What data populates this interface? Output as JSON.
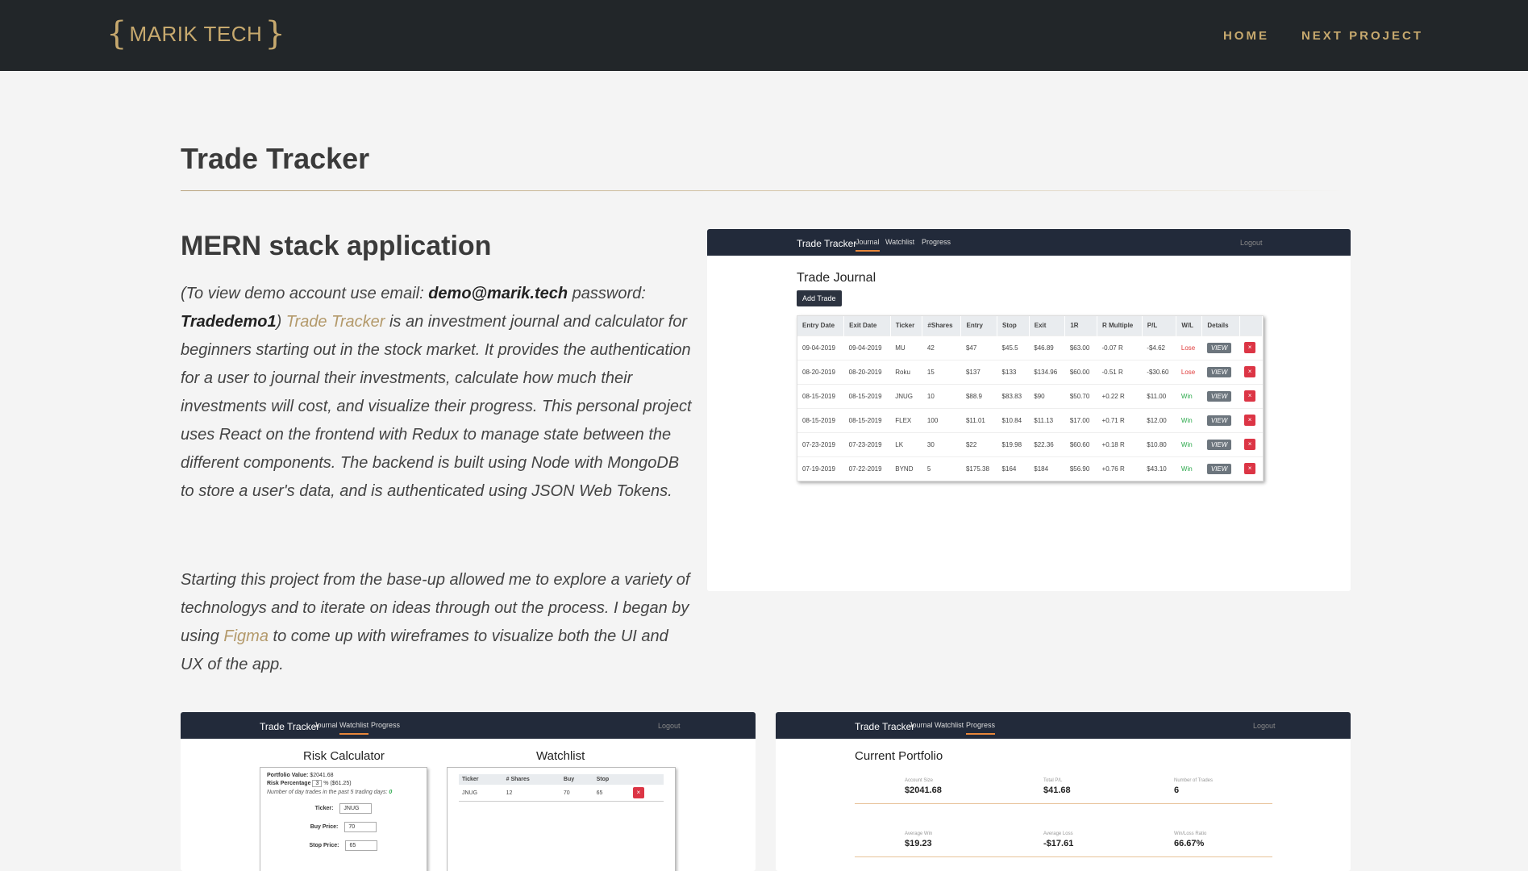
{
  "nav": {
    "logo_open": "{",
    "logo_text": "MARIK TECH",
    "logo_close": "}",
    "links": [
      "HOME",
      "NEXT PROJECT"
    ]
  },
  "page": {
    "title": "Trade Tracker",
    "section_title": "MERN stack application"
  },
  "description": {
    "p1_open_paren": "(",
    "p1_view_demo": "To view demo account use email: ",
    "p1_email": "demo@marik.tech",
    "p1_password_label": " password: ",
    "p1_password": "Tradedemo1",
    "p1_close_paren": ") ",
    "p1_link": "Trade Tracker",
    "p1_rest": " is an investment journal and calculator for beginners starting out in the stock market. It provides the authentication for a user to journal their investments, calculate how much their investments will cost, and visualize their progress. This personal project uses React on the frontend with Redux to manage state between the different components. The backend is built using Node with MongoDB to store a user's data, and is authenticated using JSON Web Tokens.",
    "p2_start": "Starting this project from the base-up allowed me to explore a variety of technologys and to iterate on ideas through out the process. I began by using ",
    "p2_link": "Figma",
    "p2_end": " to come up with wireframes to visualize both the UI and UX of the app."
  },
  "app": {
    "brand": "Trade Tracker",
    "tabs": [
      "Journal",
      "Watchlist",
      "Progress"
    ],
    "logout": "Logout"
  },
  "journal": {
    "title": "Trade Journal",
    "add_button": "Add Trade",
    "columns": [
      "Entry Date",
      "Exit Date",
      "Ticker",
      "#Shares",
      "Entry",
      "Stop",
      "Exit",
      "1R",
      "R Multiple",
      "P/L",
      "W/L",
      "Details",
      ""
    ],
    "rows": [
      [
        "09-04-2019",
        "09-04-2019",
        "MU",
        "42",
        "$47",
        "$45.5",
        "$46.89",
        "$63.00",
        "-0.07 R",
        "-$4.62",
        "Lose"
      ],
      [
        "08-20-2019",
        "08-20-2019",
        "Roku",
        "15",
        "$137",
        "$133",
        "$134.96",
        "$60.00",
        "-0.51 R",
        "-$30.60",
        "Lose"
      ],
      [
        "08-15-2019",
        "08-15-2019",
        "JNUG",
        "10",
        "$88.9",
        "$83.83",
        "$90",
        "$50.70",
        "+0.22 R",
        "$11.00",
        "Win"
      ],
      [
        "08-15-2019",
        "08-15-2019",
        "FLEX",
        "100",
        "$11.01",
        "$10.84",
        "$11.13",
        "$17.00",
        "+0.71 R",
        "$12.00",
        "Win"
      ],
      [
        "07-23-2019",
        "07-23-2019",
        "LK",
        "30",
        "$22",
        "$19.98",
        "$22.36",
        "$60.60",
        "+0.18 R",
        "$10.80",
        "Win"
      ],
      [
        "07-19-2019",
        "07-22-2019",
        "BYND",
        "5",
        "$175.38",
        "$164",
        "$184",
        "$56.90",
        "+0.76 R",
        "$43.10",
        "Win"
      ]
    ],
    "view_label": "VIEW",
    "delete_label": "×"
  },
  "risk": {
    "title": "Risk Calculator",
    "portfolio_label": "Portfolio Value:",
    "portfolio_value": "$2041.68",
    "risk_label": "Risk Percentage",
    "risk_value": "3",
    "risk_suffix": "% ($61.25)",
    "day_trades_note": "Number of day trades in the past 5 trading days:",
    "day_trades_count": "0",
    "ticker_label": "Ticker:",
    "ticker_value": "JNUG",
    "buy_label": "Buy Price:",
    "buy_value": "70",
    "stop_label": "Stop Price:",
    "stop_value": "65"
  },
  "watchlist": {
    "title": "Watchlist",
    "columns": [
      "Ticker",
      "# Shares",
      "Buy",
      "Stop",
      ""
    ],
    "rows": [
      [
        "JNUG",
        "12",
        "70",
        "65"
      ]
    ]
  },
  "portfolio": {
    "title": "Current Portfolio",
    "stats": [
      {
        "label": "Account Size",
        "value": "$2041.68"
      },
      {
        "label": "Total P/L",
        "value": "$41.68"
      },
      {
        "label": "Number of Trades",
        "value": "6"
      },
      {
        "label": "Average Win",
        "value": "$19.23"
      },
      {
        "label": "Average Loss",
        "value": "-$17.61"
      },
      {
        "label": "Win/Loss Ratio",
        "value": "66.67%"
      }
    ]
  },
  "colors": {
    "nav_bg": "#222629",
    "accent_gold": "#c7a96e",
    "app_bar": "#222a3a",
    "win": "#2aa84a",
    "lose": "#e03c3c"
  }
}
